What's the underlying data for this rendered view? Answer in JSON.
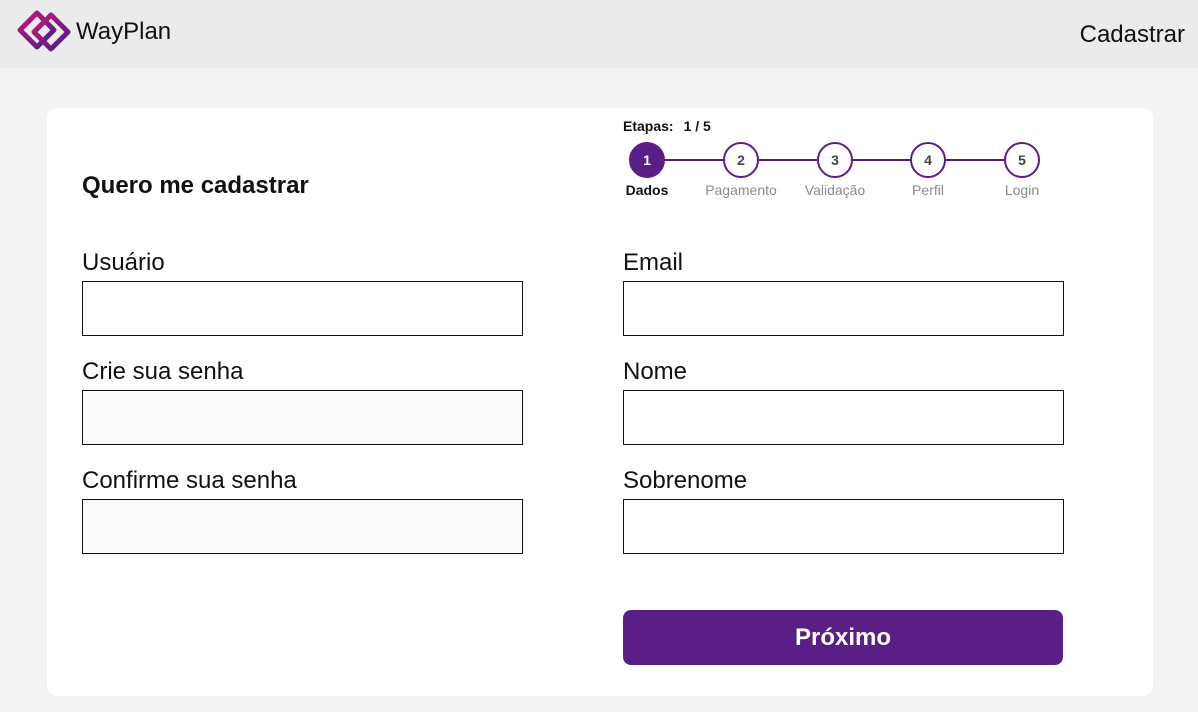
{
  "header": {
    "brand": "WayPlan",
    "nav_register": "Cadastrar"
  },
  "form": {
    "title": "Quero me cadastrar",
    "steps_label": "Etapas:",
    "steps_count": "1 / 5",
    "steps": [
      {
        "number": "1",
        "label": "Dados",
        "active": true
      },
      {
        "number": "2",
        "label": "Pagamento",
        "active": false
      },
      {
        "number": "3",
        "label": "Validação",
        "active": false
      },
      {
        "number": "4",
        "label": "Perfil",
        "active": false
      },
      {
        "number": "5",
        "label": "Login",
        "active": false
      }
    ],
    "fields": {
      "username": {
        "label": "Usuário",
        "value": ""
      },
      "password": {
        "label": "Crie sua senha",
        "value": ""
      },
      "confirm_password": {
        "label": "Confirme sua senha",
        "value": ""
      },
      "email": {
        "label": "Email",
        "value": ""
      },
      "first_name": {
        "label": "Nome",
        "value": ""
      },
      "last_name": {
        "label": "Sobrenome",
        "value": ""
      }
    },
    "next_button": "Próximo"
  },
  "colors": {
    "accent": "#5a1f87",
    "header_bg": "#ebebeb",
    "page_bg": "#f3f3f3"
  }
}
